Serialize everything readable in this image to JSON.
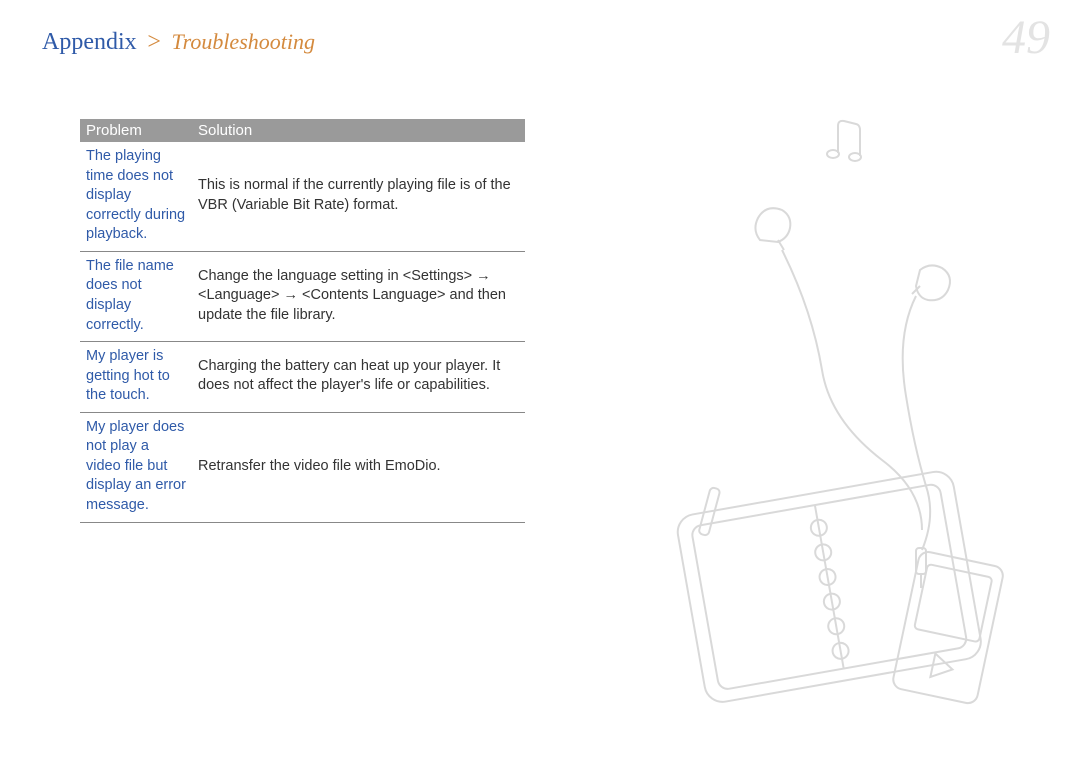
{
  "header": {
    "section": "Appendix",
    "separator": ">",
    "page": "Troubleshooting",
    "page_number": "49"
  },
  "table": {
    "head": {
      "problem": "Problem",
      "solution": "Solution"
    },
    "rows": [
      {
        "problem": "The playing time does not display correctly during playback.",
        "solution": "This is normal if the currently playing file is of the VBR (Variable Bit Rate) format."
      },
      {
        "problem": "The file name does not display correctly.",
        "solution": "Change the language setting in <Settings> → <Language> → <Contents Language> and then update the file library."
      },
      {
        "problem": "My player is getting hot to the touch.",
        "solution": "Charging the battery can heat up your player. It does not affect the player's life or capabilities."
      },
      {
        "problem": "My player does not play a video file but display an error message.",
        "solution": "Retransfer the video file with EmoDio."
      }
    ]
  }
}
